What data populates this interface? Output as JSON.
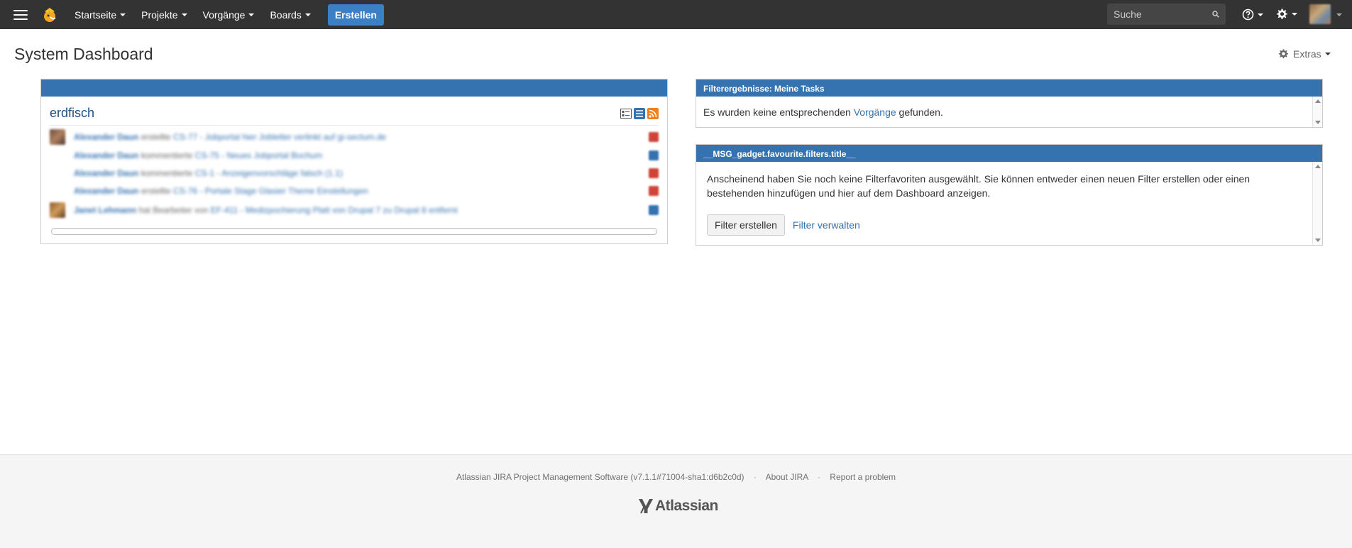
{
  "nav": {
    "items": [
      {
        "label": "Startseite"
      },
      {
        "label": "Projekte"
      },
      {
        "label": "Vorgänge"
      },
      {
        "label": "Boards"
      }
    ],
    "create_label": "Erstellen",
    "search_placeholder": "Suche"
  },
  "page": {
    "title": "System Dashboard",
    "extras_label": "Extras"
  },
  "activity_stream": {
    "header": "",
    "title": "erdfisch",
    "entries": [
      {
        "user": "Alexander Daun",
        "action": "erstellte",
        "target": "CS-77 - Jobportal hier Jobletter verlinkt auf gi-sectum.de",
        "avatar": "photo",
        "badge_color": "#d04437"
      },
      {
        "user": "Alexander Daun",
        "action": "kommentierte",
        "target": "CS-75 - Neues Jobportal Bochum",
        "avatar": "none",
        "badge_color": "#3572b0"
      },
      {
        "user": "Alexander Daun",
        "action": "kommentierte",
        "target": "CS-1 - Anzeigenvorschläge falsch (1.1)",
        "avatar": "none",
        "badge_color": "#d04437"
      },
      {
        "user": "Alexander Daun",
        "action": "erstellte",
        "target": "CS-76 - Portale Stage Glasier Theme Einstellungen",
        "avatar": "none",
        "badge_color": "#d04437"
      },
      {
        "user": "Janet Lehmann",
        "action": "hat Bearbeiter von",
        "target": "EF-411 - Medizpochierung Platt von Drupal 7 zu Drupal 8 entfernt",
        "avatar": "photo2",
        "badge_color": "#3572b0"
      }
    ]
  },
  "filter_results": {
    "header": "Filterergebnisse: Meine Tasks",
    "text_before": "Es wurden keine entsprechenden",
    "link": "Vorgänge",
    "text_after": "gefunden."
  },
  "favourite_filters": {
    "header": "__MSG_gadget.favourite.filters.title__",
    "message": "Anscheinend haben Sie noch keine Filterfavoriten ausgewählt. Sie können entweder einen neuen Filter erstellen oder einen bestehenden hinzufügen und hier auf dem Dashboard anzeigen.",
    "create_button": "Filter erstellen",
    "manage_link": "Filter verwalten"
  },
  "footer": {
    "software": "Atlassian JIRA Project Management Software (v7.1.1#71004-sha1:d6b2c0d)",
    "about": "About JIRA",
    "report": "Report a problem",
    "logo_text": "Atlassian",
    "separator": "·"
  },
  "colors": {
    "nav_bg": "#333333",
    "accent": "#3b7fc4",
    "gadget_header": "#3572b0"
  }
}
